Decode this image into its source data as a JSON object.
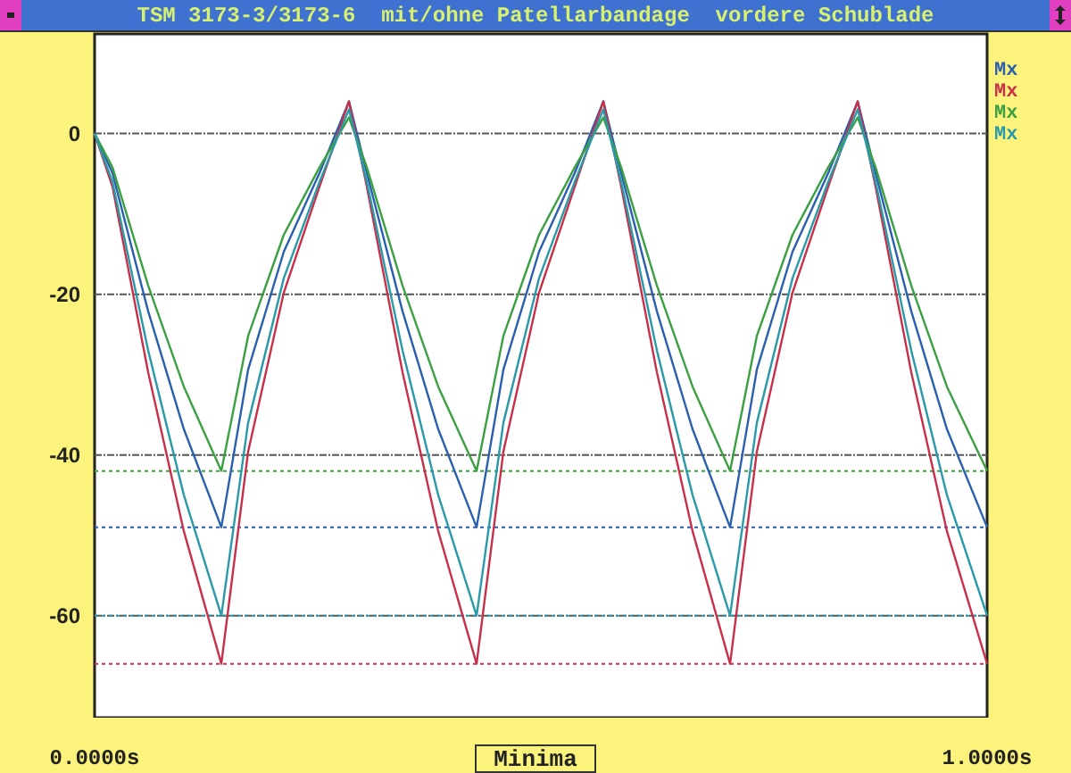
{
  "window": {
    "title": "TSM 3173-3/3173-6  mit/ohne Patellarbandage  vordere Schublade"
  },
  "chart_data": {
    "type": "line",
    "x": [
      0,
      0.02,
      0.06,
      0.1,
      0.142,
      0.172,
      0.212,
      0.252,
      0.285,
      0.305,
      0.345,
      0.385,
      0.428,
      0.458,
      0.498,
      0.538,
      0.57,
      0.59,
      0.63,
      0.67,
      0.712,
      0.742,
      0.782,
      0.822,
      0.855,
      0.875,
      0.915,
      0.955,
      1.0
    ],
    "series": [
      {
        "name": "Mx",
        "color": "#2a5fb0",
        "values": [
          0,
          -4.9,
          -22.1,
          -36.8,
          -49,
          -29.4,
          -14.7,
          -4.9,
          4,
          -4.9,
          -22.1,
          -36.8,
          -49,
          -29.4,
          -14.7,
          -4.9,
          4,
          -4.9,
          -22.1,
          -36.8,
          -49,
          -29.4,
          -14.7,
          -4.9,
          4,
          -4.9,
          -22.1,
          -36.8,
          -49
        ]
      },
      {
        "name": "Mx",
        "color": "#c8304a",
        "values": [
          0,
          -6.6,
          -29.7,
          -49.5,
          -66,
          -39.6,
          -19.8,
          -6.6,
          4,
          -6.6,
          -29.7,
          -49.5,
          -66,
          -39.6,
          -19.8,
          -6.6,
          4,
          -6.6,
          -29.7,
          -49.5,
          -66,
          -39.6,
          -19.8,
          -6.6,
          4,
          -6.6,
          -29.7,
          -49.5,
          -66
        ]
      },
      {
        "name": "Mx",
        "color": "#3aa040",
        "values": [
          0,
          -4.2,
          -18.9,
          -31.5,
          -42,
          -25.2,
          -12.6,
          -4.2,
          2,
          -4.2,
          -18.9,
          -31.5,
          -42,
          -25.2,
          -12.6,
          -4.2,
          2,
          -4.2,
          -18.9,
          -31.5,
          -42,
          -25.2,
          -12.6,
          -4.2,
          2,
          -4.2,
          -18.9,
          -31.5,
          -42
        ]
      },
      {
        "name": "Mx",
        "color": "#2a9aa8",
        "values": [
          0,
          -6,
          -27,
          -45,
          -60,
          -36,
          -18,
          -6,
          3,
          -6,
          -27,
          -45,
          -60,
          -36,
          -18,
          -6,
          3,
          -6,
          -27,
          -45,
          -60,
          -36,
          -18,
          -6,
          3,
          -6,
          -27,
          -45,
          -60
        ]
      }
    ],
    "grid": true,
    "ref_lines": [
      {
        "axis": "y",
        "value": -49,
        "color": "#2a5fb0"
      },
      {
        "axis": "y",
        "value": -66,
        "color": "#c8304a"
      },
      {
        "axis": "y",
        "value": -42,
        "color": "#3aa040"
      },
      {
        "axis": "y",
        "value": -60,
        "color": "#2a9aa8"
      }
    ],
    "xlim": [
      0,
      1
    ],
    "ylim": [
      -72.7,
      12.4
    ],
    "yticks": [
      0,
      -20,
      -40,
      -60
    ],
    "xticks": [
      {
        "value": 0,
        "label": "0.0000s"
      },
      {
        "value": 1,
        "label": "1.0000s"
      }
    ]
  },
  "button": {
    "label": "Minima"
  }
}
